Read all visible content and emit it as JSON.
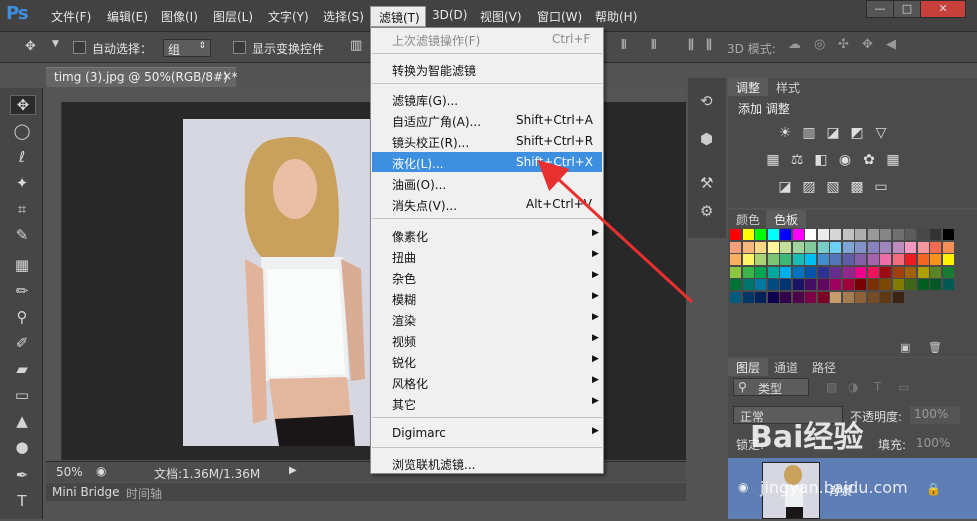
{
  "app_logo": "Ps",
  "menubar": {
    "items": [
      "文件(F)",
      "编辑(E)",
      "图像(I)",
      "图层(L)",
      "文字(Y)",
      "选择(S)",
      "滤镜(T)",
      "3D(D)",
      "视图(V)",
      "窗口(W)",
      "帮助(H)"
    ],
    "active": "滤镜(T)"
  },
  "window_controls": {
    "minimize": "—",
    "restore": "□",
    "close": "✕"
  },
  "options_bar": {
    "auto_select_label": "自动选择：",
    "auto_select_value": "组",
    "show_transform_label": "显示变换控件",
    "mode_3d_label": "3D 模式:"
  },
  "document": {
    "tab_title": "timg (3).jpg @ 50%(RGB/8#) *",
    "close_glyph": "×",
    "zoom": "50%",
    "doc_size": "文档:1.36M/1.36M"
  },
  "bottom_tabs": [
    "Mini Bridge",
    "时间轴"
  ],
  "filter_menu": {
    "items": [
      {
        "label": "上次滤镜操作(F)",
        "shortcut": "Ctrl+F",
        "disabled": true
      },
      {
        "sep": true
      },
      {
        "label": "转换为智能滤镜"
      },
      {
        "sep": true
      },
      {
        "label": "滤镜库(G)..."
      },
      {
        "label": "自适应广角(A)...",
        "shortcut": "Shift+Ctrl+A"
      },
      {
        "label": "镜头校正(R)...",
        "shortcut": "Shift+Ctrl+R"
      },
      {
        "label": "液化(L)...",
        "shortcut": "Shift+Ctrl+X",
        "highlight": true
      },
      {
        "label": "油画(O)..."
      },
      {
        "label": "消失点(V)...",
        "shortcut": "Alt+Ctrl+V"
      },
      {
        "sep": true
      },
      {
        "label": "像素化",
        "submenu": true
      },
      {
        "label": "扭曲",
        "submenu": true
      },
      {
        "label": "杂色",
        "submenu": true
      },
      {
        "label": "模糊",
        "submenu": true
      },
      {
        "label": "渲染",
        "submenu": true
      },
      {
        "label": "视频",
        "submenu": true
      },
      {
        "label": "锐化",
        "submenu": true
      },
      {
        "label": "风格化",
        "submenu": true
      },
      {
        "label": "其它",
        "submenu": true
      },
      {
        "sep": true
      },
      {
        "label": "Digimarc",
        "submenu": true
      },
      {
        "sep": true
      },
      {
        "label": "浏览联机滤镜..."
      }
    ]
  },
  "adjust_panel": {
    "tabs": [
      "调整",
      "样式"
    ],
    "title": "添加 调整"
  },
  "swatch_panel": {
    "tabs": [
      "颜色",
      "色板"
    ],
    "colors": [
      "#ff0000",
      "#ffff00",
      "#00ff00",
      "#00ffff",
      "#0000ff",
      "#ff00ff",
      "#ffffff",
      "#ebebeb",
      "#d6d6d6",
      "#c2c2c2",
      "#adadad",
      "#999999",
      "#858585",
      "#707070",
      "#5c5c5c",
      "#474747",
      "#333333",
      "#000000",
      "#f4a07a",
      "#f7b77a",
      "#fdd882",
      "#fff799",
      "#c4df9b",
      "#a3d49d",
      "#82ca9c",
      "#7accc8",
      "#6dcff6",
      "#7ea7d8",
      "#8393ca",
      "#8781bd",
      "#a186be",
      "#bc8cbf",
      "#f49ac1",
      "#f5989d",
      "#f26c4f",
      "#f68e55",
      "#fbaf5c",
      "#fff467",
      "#acd372",
      "#7cc576",
      "#3bb878",
      "#1abbb4",
      "#00bff3",
      "#438ccb",
      "#5574b9",
      "#605ca9",
      "#855fa8",
      "#a763a9",
      "#ef6ea8",
      "#f16d7e",
      "#ed1c24",
      "#f26522",
      "#f7941d",
      "#fff200",
      "#8dc63f",
      "#39b54a",
      "#00a651",
      "#00a99d",
      "#00aeef",
      "#0072bc",
      "#0054a6",
      "#2e3192",
      "#662d91",
      "#92278f",
      "#ec008c",
      "#ed145b",
      "#9e0b0f",
      "#a0410d",
      "#a3620a",
      "#aba000",
      "#598527",
      "#197b30",
      "#007236",
      "#00746b",
      "#0076a3",
      "#004a80",
      "#003471",
      "#1b1464",
      "#440e62",
      "#630460",
      "#9e005d",
      "#9e0039",
      "#790000",
      "#7b2e00",
      "#7d4900",
      "#827b00",
      "#406618",
      "#005e20",
      "#005826",
      "#005952",
      "#005b7f",
      "#003663",
      "#002157",
      "#0d004c",
      "#32004b",
      "#4b0049",
      "#7b0046",
      "#7a0026",
      "#c69c6d",
      "#a67c52",
      "#8c6239",
      "#754c24",
      "#603913",
      "#3c2415"
    ]
  },
  "layers_panel": {
    "tabs": [
      "图层",
      "通道",
      "路径"
    ],
    "kind_filter": "类型",
    "blend_mode": "正常",
    "opacity_label": "不透明度:",
    "opacity_value": "100%",
    "lock_label": "锁定:",
    "fill_label": "填充:",
    "fill_value": "100%",
    "layer_name": "背景"
  },
  "watermark": {
    "brand": "Bai经验",
    "url": "jingyan.baidu.com"
  }
}
